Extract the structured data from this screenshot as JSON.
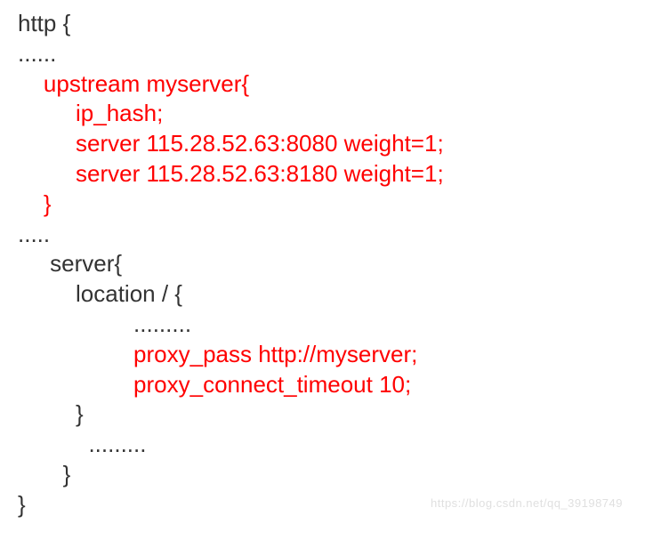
{
  "lines": [
    {
      "text": "http {",
      "red": false
    },
    {
      "text": "......",
      "red": false
    },
    {
      "text": "    upstream myserver{",
      "red": true
    },
    {
      "text": "         ip_hash;",
      "red": true
    },
    {
      "text": "         server 115.28.52.63:8080 weight=1;",
      "red": true
    },
    {
      "text": "         server 115.28.52.63:8180 weight=1;",
      "red": true
    },
    {
      "text": "    }",
      "red": true
    },
    {
      "text": ".....",
      "red": false
    },
    {
      "text": "     server{",
      "red": false
    },
    {
      "text": "         location / {",
      "red": false
    },
    {
      "text": "                  .........",
      "red": false
    },
    {
      "text": "                  proxy_pass http://myserver;",
      "red": true
    },
    {
      "text": "                  proxy_connect_timeout 10;",
      "red": true
    },
    {
      "text": "         }",
      "red": false
    },
    {
      "text": "           .........",
      "red": false
    },
    {
      "text": "       }",
      "red": false
    },
    {
      "text": "}",
      "red": false
    }
  ],
  "watermark": "https://blog.csdn.net/qq_39198749"
}
